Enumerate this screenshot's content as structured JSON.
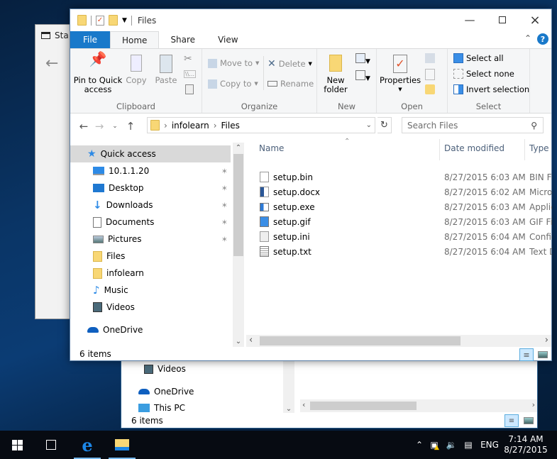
{
  "background_settings_window": {
    "title": "Sta"
  },
  "background_explorer": {
    "nav_items": [
      {
        "label": "Videos",
        "icon": "videos-icon"
      },
      {
        "label": "OneDrive",
        "icon": "onedrive-icon"
      },
      {
        "label": "This PC",
        "icon": "this-pc-icon"
      }
    ],
    "status": "6 items"
  },
  "window": {
    "title": "Files",
    "controls": {
      "minimize": "minimize-icon",
      "maximize": "maximize-icon",
      "close": "close-icon"
    },
    "tabs": [
      {
        "label": "File"
      },
      {
        "label": "Home"
      },
      {
        "label": "Share"
      },
      {
        "label": "View"
      }
    ],
    "help": "?"
  },
  "ribbon": {
    "clipboard": {
      "label": "Clipboard",
      "pin": "Pin to Quick access",
      "pin_line1": "Pin to Quick",
      "pin_line2": "access",
      "copy": "Copy",
      "paste": "Paste"
    },
    "organize": {
      "label": "Organize",
      "move_to": "Move to",
      "copy_to": "Copy to",
      "delete": "Delete",
      "rename": "Rename"
    },
    "new": {
      "label": "New",
      "new_folder_line1": "New",
      "new_folder_line2": "folder"
    },
    "open": {
      "label": "Open",
      "properties": "Properties"
    },
    "select": {
      "label": "Select",
      "select_all": "Select all",
      "select_none": "Select none",
      "invert": "Invert selection"
    }
  },
  "address": {
    "breadcrumb": [
      "infolearn",
      "Files"
    ],
    "search_placeholder": "Search Files"
  },
  "nav": {
    "items": [
      {
        "label": "Quick access",
        "icon": "quick-access-icon",
        "pinned": false
      },
      {
        "label": "10.1.1.20",
        "icon": "network-pc-icon",
        "pinned": true
      },
      {
        "label": "Desktop",
        "icon": "desktop-icon",
        "pinned": true
      },
      {
        "label": "Downloads",
        "icon": "downloads-icon",
        "pinned": true
      },
      {
        "label": "Documents",
        "icon": "documents-icon",
        "pinned": true
      },
      {
        "label": "Pictures",
        "icon": "pictures-icon",
        "pinned": true
      },
      {
        "label": "Files",
        "icon": "folder-icon",
        "pinned": false
      },
      {
        "label": "infolearn",
        "icon": "folder-icon",
        "pinned": false
      },
      {
        "label": "Music",
        "icon": "music-icon",
        "pinned": false
      },
      {
        "label": "Videos",
        "icon": "videos-icon",
        "pinned": false
      },
      {
        "label": "OneDrive",
        "icon": "onedrive-icon",
        "pinned": false
      }
    ]
  },
  "files": {
    "columns": [
      "Name",
      "Date modified",
      "Type"
    ],
    "rows": [
      {
        "name": "setup.bin",
        "date": "8/27/2015 6:03 AM",
        "type": "BIN File",
        "icon": "bin-file-icon"
      },
      {
        "name": "setup.docx",
        "date": "8/27/2015 6:02 AM",
        "type": "Microsoft Word Document",
        "icon": "word-file-icon"
      },
      {
        "name": "setup.exe",
        "date": "8/27/2015 6:03 AM",
        "type": "Application",
        "icon": "exe-file-icon"
      },
      {
        "name": "setup.gif",
        "date": "8/27/2015 6:03 AM",
        "type": "GIF File",
        "icon": "gif-file-icon"
      },
      {
        "name": "setup.ini",
        "date": "8/27/2015 6:04 AM",
        "type": "Configuration settings",
        "icon": "ini-file-icon"
      },
      {
        "name": "setup.txt",
        "date": "8/27/2015 6:04 AM",
        "type": "Text Document",
        "icon": "txt-file-icon"
      }
    ]
  },
  "status": {
    "items": "6 items"
  },
  "taskbar": {
    "time": "7:14 AM",
    "date": "8/27/2015",
    "lang": "ENG",
    "apps": [
      {
        "name": "start",
        "icon": "windows-start-icon"
      },
      {
        "name": "task-view",
        "icon": "task-view-icon"
      },
      {
        "name": "edge",
        "icon": "edge-icon"
      },
      {
        "name": "file-explorer",
        "icon": "file-explorer-icon"
      }
    ]
  },
  "colors": {
    "accent": "#1979ca",
    "selection": "#cce8ff",
    "taskbar": "#070b12"
  }
}
